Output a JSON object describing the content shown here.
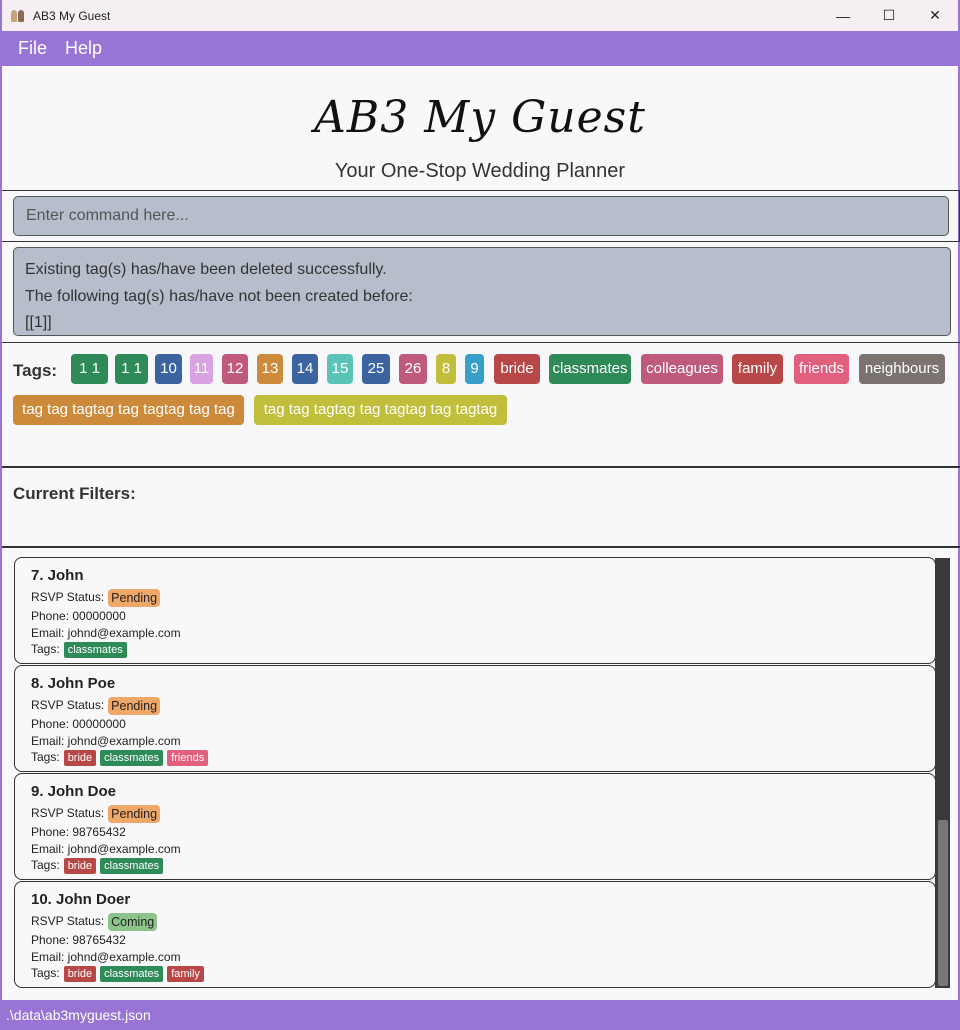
{
  "window": {
    "title": "AB3 My Guest",
    "minimize": "—",
    "maximize": "☐",
    "close": "✕"
  },
  "menu": {
    "file": "File",
    "help": "Help"
  },
  "header": {
    "title": "AB3 My Guest",
    "subtitle": "Your One-Stop Wedding Planner"
  },
  "command": {
    "placeholder": "Enter command here..."
  },
  "result": {
    "lines": [
      "Existing tag(s) has/have been deleted successfully.",
      "The following tag(s) has/have not been created before:",
      "[[1]]"
    ]
  },
  "tags_panel": {
    "label": "Tags:",
    "tags": [
      {
        "label": "1  1",
        "color": "#2e8b57"
      },
      {
        "label": "1 1",
        "color": "#2e8b57"
      },
      {
        "label": "10",
        "color": "#3b64a0"
      },
      {
        "label": "11",
        "color": "#d8a3e0"
      },
      {
        "label": "12",
        "color": "#c05a7a"
      },
      {
        "label": "13",
        "color": "#cd8a3a"
      },
      {
        "label": "14",
        "color": "#3b64a0"
      },
      {
        "label": "15",
        "color": "#5bc4b8"
      },
      {
        "label": "25",
        "color": "#3b64a0"
      },
      {
        "label": "26",
        "color": "#c05a7a"
      },
      {
        "label": "8",
        "color": "#c0be3a"
      },
      {
        "label": "9",
        "color": "#38a0c8"
      },
      {
        "label": "bride",
        "color": "#b84848"
      },
      {
        "label": "classmates",
        "color": "#2e8b57"
      },
      {
        "label": "colleagues",
        "color": "#c05a7a"
      },
      {
        "label": "family",
        "color": "#b84848"
      },
      {
        "label": "friends",
        "color": "#e0607e"
      },
      {
        "label": "neighbours",
        "color": "#7a7370"
      },
      {
        "label": "tag tag tagtag tag tagtag tag tag",
        "color": "#cd8a3a"
      },
      {
        "label": "tag tag tagtag tag tagtag tag tagtag",
        "color": "#c0be3a"
      }
    ]
  },
  "filters": {
    "label": "Current Filters:"
  },
  "guests": [
    {
      "name": "7.  John",
      "rsvp_label": "RSVP Status:",
      "rsvp": "Pending",
      "rsvp_color": "#f0a868",
      "phone": "Phone: 00000000",
      "email": "Email: johnd@example.com",
      "tags_label": "Tags:",
      "tags": [
        {
          "label": "classmates",
          "color": "#2e8b57"
        }
      ]
    },
    {
      "name": "8.  John Poe",
      "rsvp_label": "RSVP Status:",
      "rsvp": "Pending",
      "rsvp_color": "#f0a868",
      "phone": "Phone: 00000000",
      "email": "Email: johnd@example.com",
      "tags_label": "Tags:",
      "tags": [
        {
          "label": "bride",
          "color": "#b84848"
        },
        {
          "label": "classmates",
          "color": "#2e8b57"
        },
        {
          "label": "friends",
          "color": "#e0607e"
        }
      ]
    },
    {
      "name": "9.  John Doe",
      "rsvp_label": "RSVP Status:",
      "rsvp": "Pending",
      "rsvp_color": "#f0a868",
      "phone": "Phone: 98765432",
      "email": "Email: johnd@example.com",
      "tags_label": "Tags:",
      "tags": [
        {
          "label": "bride",
          "color": "#b84848"
        },
        {
          "label": "classmates",
          "color": "#2e8b57"
        }
      ]
    },
    {
      "name": "10.  John Doer",
      "rsvp_label": "RSVP Status:",
      "rsvp": "Coming",
      "rsvp_color": "#8cc48c",
      "phone": "Phone: 98765432",
      "email": "Email: johnd@example.com",
      "tags_label": "Tags:",
      "tags": [
        {
          "label": "bride",
          "color": "#b84848"
        },
        {
          "label": "classmates",
          "color": "#2e8b57"
        },
        {
          "label": "family",
          "color": "#b84848"
        }
      ]
    }
  ],
  "statusbar": {
    "path": ".\\data\\ab3myguest.json"
  }
}
